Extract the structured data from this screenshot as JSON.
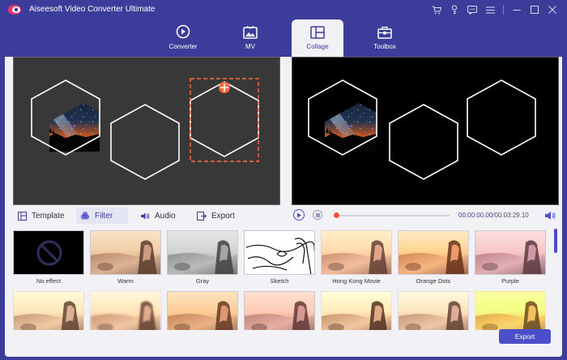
{
  "app": {
    "title": "Aiseesoft Video Converter Ultimate"
  },
  "titlebar_icons": [
    "cart-icon",
    "key-icon",
    "chat-icon",
    "menu-icon",
    "minimize-icon",
    "maximize-icon",
    "close-icon"
  ],
  "main_tabs": [
    {
      "label": "Converter",
      "icon": "converter-icon",
      "active": false
    },
    {
      "label": "MV",
      "icon": "mv-icon",
      "active": false
    },
    {
      "label": "Collage",
      "icon": "collage-icon",
      "active": true
    },
    {
      "label": "Toolbox",
      "icon": "toolbox-icon",
      "active": false
    }
  ],
  "edit_tabs": [
    {
      "label": "Template",
      "icon": "template-icon",
      "active": false
    },
    {
      "label": "Filter",
      "icon": "filter-icon",
      "active": true
    },
    {
      "label": "Audio",
      "icon": "audio-icon",
      "active": false
    },
    {
      "label": "Export",
      "icon": "export-icon",
      "active": false
    }
  ],
  "playback": {
    "current_time": "00:00:00.00",
    "total_time": "/00:03:29.10",
    "progress": 0.0
  },
  "filters": [
    {
      "label": "No effect"
    },
    {
      "label": "Warm"
    },
    {
      "label": "Gray"
    },
    {
      "label": "Sketch"
    },
    {
      "label": "Hong Kong Movie"
    },
    {
      "label": "Orange Dots"
    },
    {
      "label": "Purple"
    },
    {
      "label": ""
    },
    {
      "label": ""
    },
    {
      "label": ""
    },
    {
      "label": ""
    },
    {
      "label": ""
    },
    {
      "label": ""
    },
    {
      "label": ""
    }
  ],
  "export_button": {
    "label": "Export"
  },
  "colors": {
    "brand": "#3c3d9a",
    "accent": "#4c4dc9",
    "highlight": "#ff4d3a",
    "selection": "#ff6a3d"
  }
}
